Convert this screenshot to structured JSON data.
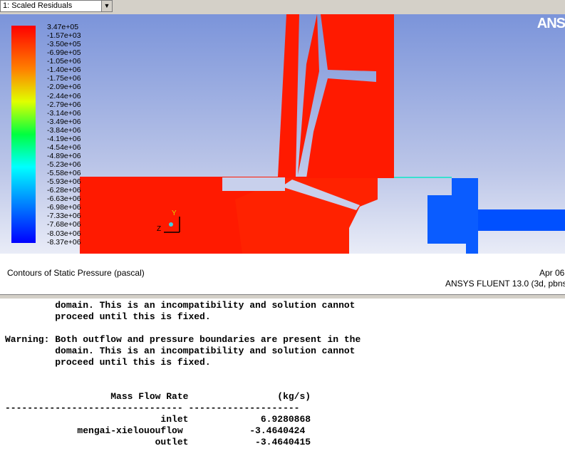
{
  "toolbar": {
    "window_select": "1: Scaled Residuals",
    "dropdown_icon": "down-arrow-icon"
  },
  "brand": {
    "logo_text": "ANS"
  },
  "legend": {
    "labels": [
      "3.47e+05",
      "-1.57e+03",
      "-3.50e+05",
      "-6.99e+05",
      "-1.05e+06",
      "-1.40e+06",
      "-1.75e+06",
      "-2.09e+06",
      "-2.44e+06",
      "-2.79e+06",
      "-3.14e+06",
      "-3.49e+06",
      "-3.84e+06",
      "-4.19e+06",
      "-4.54e+06",
      "-4.89e+06",
      "-5.23e+06",
      "-5.58e+06",
      "-5.93e+06",
      "-6.28e+06",
      "-6.63e+06",
      "-6.98e+06",
      "-7.33e+06",
      "-7.68e+06",
      "-8.03e+06",
      "-8.37e+06"
    ],
    "colors": [
      "#ff0000",
      "#0000ff"
    ]
  },
  "axes": {
    "y_label": "Y",
    "z_label": "Z",
    "x_label": "X"
  },
  "caption": {
    "title": "Contours of Static Pressure (pascal)",
    "date": "Apr 06",
    "version": "ANSYS FLUENT 13.0 (3d, pbns"
  },
  "console": {
    "text": "         domain. This is an incompatibility and solution cannot\n         proceed until this is fixed.\n\nWarning: Both outflow and pressure boundaries are present in the\n         domain. This is an incompatibility and solution cannot\n         proceed until this is fixed.\n\n\n                   Mass Flow Rate                (kg/s)\n-------------------------------- --------------------\n                            inlet             6.9280868\n             mengai-xielououflow            -3.4640424\n                           outlet            -3.4640415"
  }
}
